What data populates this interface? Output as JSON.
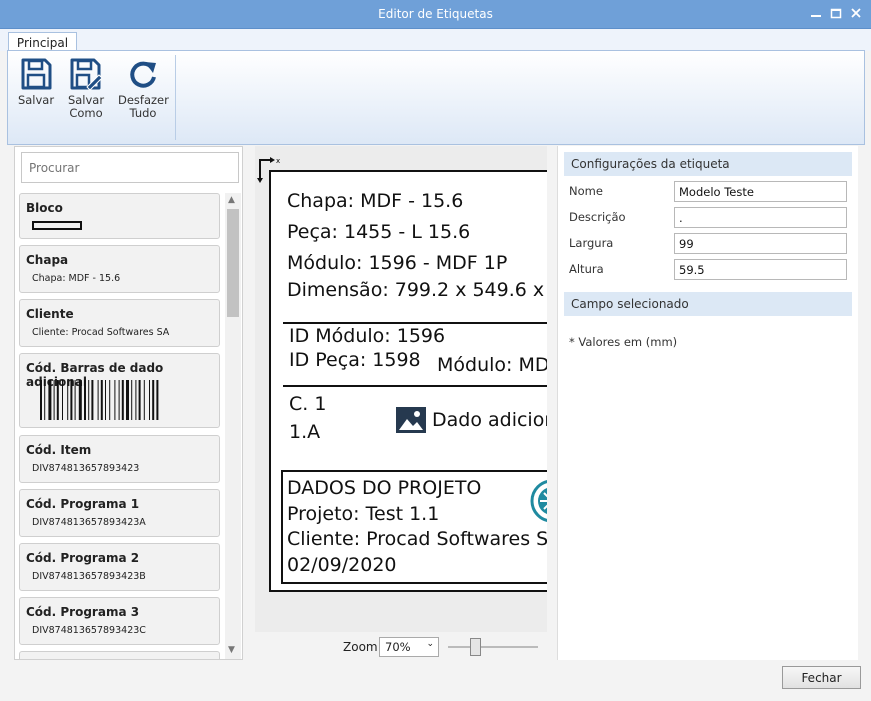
{
  "window": {
    "title": "Editor de Etiquetas"
  },
  "tabs": [
    {
      "label": "Principal"
    }
  ],
  "ribbon": {
    "save": "Salvar",
    "save_as_1": "Salvar",
    "save_as_2": "Como",
    "undo_1": "Desfazer",
    "undo_2": "Tudo"
  },
  "left_panel": {
    "search_placeholder": "Procurar",
    "items": [
      {
        "title": "Bloco",
        "value": ""
      },
      {
        "title": "Chapa",
        "value": "Chapa: MDF - 15.6"
      },
      {
        "title": "Cliente",
        "value": "Cliente: Procad Softwares SA"
      },
      {
        "title": "Cód. Barras de dado adicional",
        "value": ""
      },
      {
        "title": "Cód. Item",
        "value": "DIV874813657893423"
      },
      {
        "title": "Cód. Programa 1",
        "value": "DIV874813657893423A"
      },
      {
        "title": "Cód. Programa 2",
        "value": "DIV874813657893423B"
      },
      {
        "title": "Cód. Programa 3",
        "value": "DIV874813657893423C"
      }
    ]
  },
  "label_preview": {
    "line1": "Chapa: MDF - 15.6",
    "line2": "Peça: 1455 - L 15.6",
    "line3": "Módulo: 1596 - MDF 1P",
    "line4": "Dimensão: 799.2 x 549.6 x",
    "id_modulo": "ID Módulo: 1596",
    "id_peca": "ID Peça: 1598",
    "modulo_md": "Módulo: MD",
    "c1": "C. 1",
    "a1": "1.A",
    "dado_adicional": "Dado adicion",
    "projeto_header": "DADOS DO PROJETO",
    "projeto": "Projeto: Test 1.1",
    "cliente": "Cliente: Procad Softwares S",
    "data": "02/09/2020"
  },
  "zoom": {
    "label": "Zoom",
    "value": "70%"
  },
  "settings": {
    "header": "Configurações da etiqueta",
    "fields": [
      {
        "label": "Nome",
        "value": "Modelo Teste"
      },
      {
        "label": "Descrição",
        "value": "."
      },
      {
        "label": "Largura",
        "value": "99"
      },
      {
        "label": "Altura",
        "value": "59.5"
      }
    ],
    "selected_header": "Campo selecionado",
    "note": "* Valores em (mm)"
  },
  "footer": {
    "close": "Fechar"
  },
  "colors": {
    "titlebar": "#6fa0d8",
    "ribbon_bg": "#dde8f6",
    "section_header": "#dce8f5",
    "icon": "#1f4e85"
  }
}
